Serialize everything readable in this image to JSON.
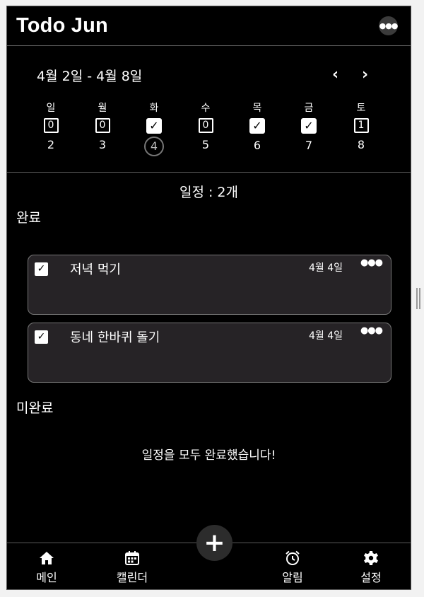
{
  "app": {
    "title": "Todo Jun",
    "more_icon": "ellipsis-icon"
  },
  "week": {
    "range": "4월 2일 - 4월 8일",
    "prev_icon": "chevron-left-icon",
    "next_icon": "chevron-right-icon",
    "days": [
      {
        "name": "일",
        "status": "0",
        "checked": false,
        "date": "2",
        "today": false
      },
      {
        "name": "월",
        "status": "0",
        "checked": false,
        "date": "3",
        "today": false
      },
      {
        "name": "화",
        "status": "",
        "checked": true,
        "date": "4",
        "today": true
      },
      {
        "name": "수",
        "status": "0",
        "checked": false,
        "date": "5",
        "today": false
      },
      {
        "name": "목",
        "status": "",
        "checked": true,
        "date": "6",
        "today": false
      },
      {
        "name": "금",
        "status": "",
        "checked": true,
        "date": "7",
        "today": false
      },
      {
        "name": "토",
        "status": "1",
        "checked": false,
        "date": "8",
        "today": false
      }
    ]
  },
  "summary": "일정 : 2개",
  "completed": {
    "title": "완료",
    "tasks": [
      {
        "title": "저녁 먹기",
        "date": "4월 4일",
        "checked": true
      },
      {
        "title": "동네 한바퀴 돌기",
        "date": "4월 4일",
        "checked": true
      }
    ]
  },
  "incomplete": {
    "title": "미완료",
    "empty_message": "일정을 모두 완료했습니다!"
  },
  "bottom_nav": {
    "items": [
      {
        "label": "메인",
        "icon": "home-icon"
      },
      {
        "label": "캘린더",
        "icon": "calendar-icon"
      },
      {
        "label": "알림",
        "icon": "alarm-clock-icon"
      },
      {
        "label": "설정",
        "icon": "gear-icon"
      }
    ],
    "add_icon": "plus-icon"
  }
}
